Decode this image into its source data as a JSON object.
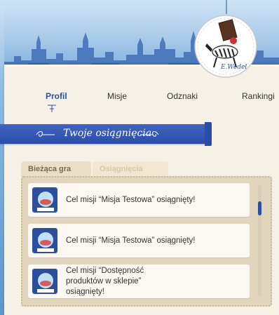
{
  "header": {
    "badge_brand": "E.Wedel",
    "badge_icon": "zebra-chocolate-badge"
  },
  "nav": {
    "items": [
      {
        "label": "Profil",
        "active": true
      },
      {
        "label": "Misje",
        "active": false
      },
      {
        "label": "Odznaki",
        "active": false
      },
      {
        "label": "Rankingi",
        "active": false
      }
    ]
  },
  "section": {
    "title": "Twoje osiągnięcia"
  },
  "tabs": [
    {
      "label": "Bieżąca gra",
      "active": true
    },
    {
      "label": "Osiągnięcia",
      "active": false
    }
  ],
  "feed": {
    "items": [
      {
        "text": "Cel misji “Misja Testowa” osiągnięty!",
        "icon": "mission-badge-icon"
      },
      {
        "text": "Cel misji “Misja Testowa” osiągnięty!",
        "icon": "mission-badge-icon"
      },
      {
        "text": "Cel misji “Dostępność produktów w sklepie” osiągnięty!",
        "icon": "mission-badge-icon"
      }
    ]
  },
  "colors": {
    "accent": "#2d4f9e",
    "ribbon": "#2a4ea8",
    "panel": "#f6f1e6",
    "feed_bg": "#e1d5bd"
  }
}
